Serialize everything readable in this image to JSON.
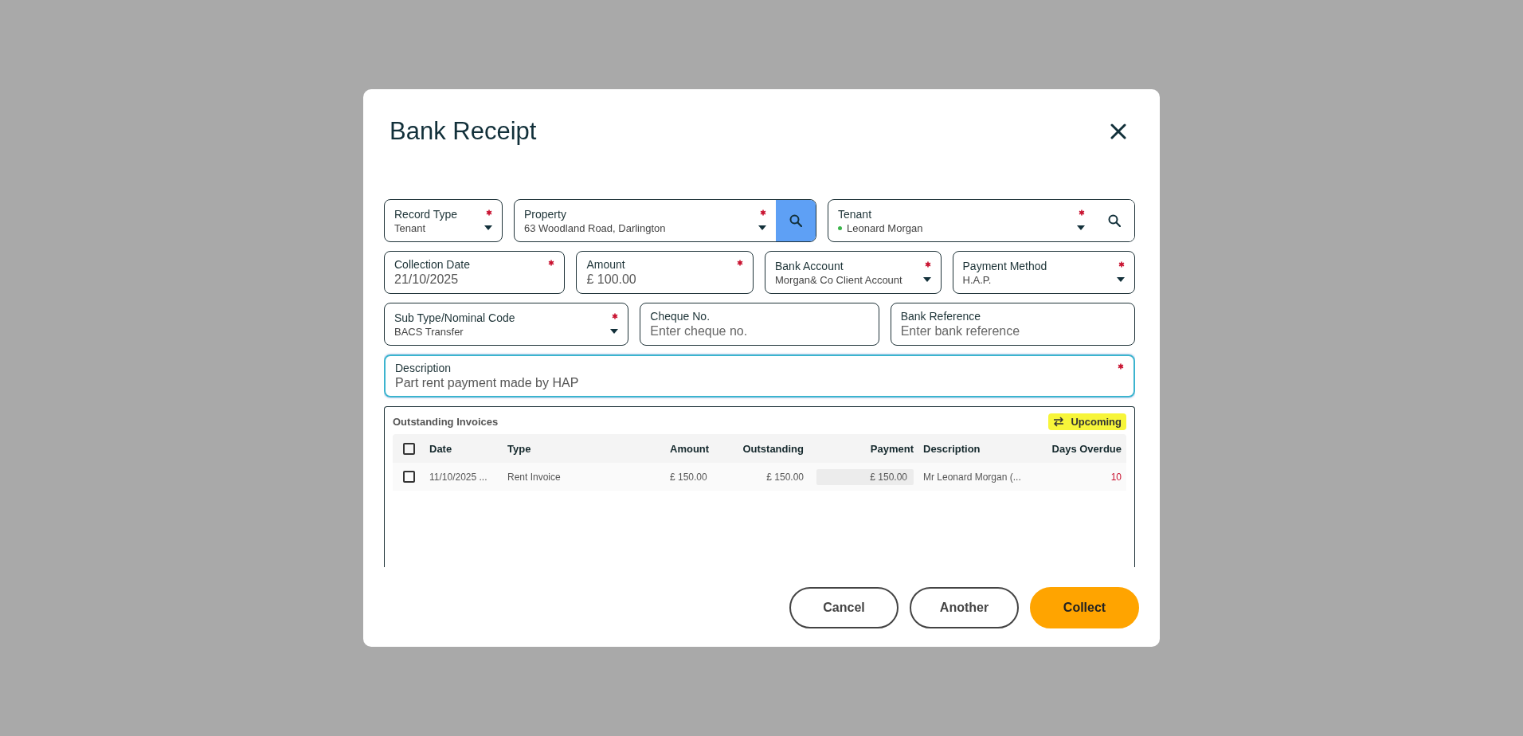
{
  "dialog": {
    "title": "Bank Receipt",
    "field_rows": [
      [
        {
          "kind": "select",
          "label": "Record Type",
          "value": "Tenant",
          "required": true
        },
        {
          "kind": "lookup",
          "label": "Property",
          "value": "63 Woodland Road, Darlington",
          "required": true,
          "search_highlighted": true
        },
        {
          "kind": "lookup",
          "label": "Tenant",
          "value": "Leonard Morgan",
          "color": "#3bb54a",
          "required": true,
          "search_highlighted": false
        }
      ],
      [
        {
          "kind": "text",
          "label": "Collection Date",
          "value": "21/10/2025",
          "required": true
        },
        {
          "kind": "text",
          "label": "Amount",
          "value": "£ 100.00",
          "required": true
        },
        {
          "kind": "select",
          "label": "Bank Account",
          "value": "Morgan& Co Client Account",
          "required": true
        },
        {
          "kind": "select",
          "label": "Payment Method",
          "value": "H.A.P.",
          "required": true
        }
      ],
      [
        {
          "kind": "select",
          "label": "Sub Type/Nominal Code",
          "value": "BACS Transfer",
          "required": true
        },
        {
          "kind": "text",
          "label": "Cheque No.",
          "placeholder": "Enter cheque no.",
          "required": false
        },
        {
          "kind": "text",
          "label": "Bank Reference",
          "placeholder": "Enter bank reference",
          "required": false
        }
      ],
      [
        {
          "kind": "text",
          "label": "Description",
          "value": "Part rent payment made by HAP",
          "required": true,
          "focused": true
        }
      ]
    ],
    "invoices": {
      "title": "Outstanding Invoices",
      "filter": "Upcoming",
      "all_checked": false,
      "columns": [
        "Date",
        "Type",
        "Amount",
        "Outstanding",
        "Payment",
        "Description",
        "Days Overdue"
      ],
      "rows": [
        {
          "checked": false,
          "date": "11/10/2025 ...",
          "type": "Rent Invoice",
          "amount": "£ 150.00",
          "outstanding": "£ 150.00",
          "payment": "£ 150.00",
          "description": "Mr Leonard Morgan (...",
          "days_overdue": "10",
          "overdue": true
        }
      ]
    },
    "buttons": [
      {
        "label": "Cancel",
        "kind": "outline"
      },
      {
        "label": "Another",
        "kind": "outline"
      },
      {
        "label": "Collect",
        "kind": "primary"
      }
    ]
  }
}
